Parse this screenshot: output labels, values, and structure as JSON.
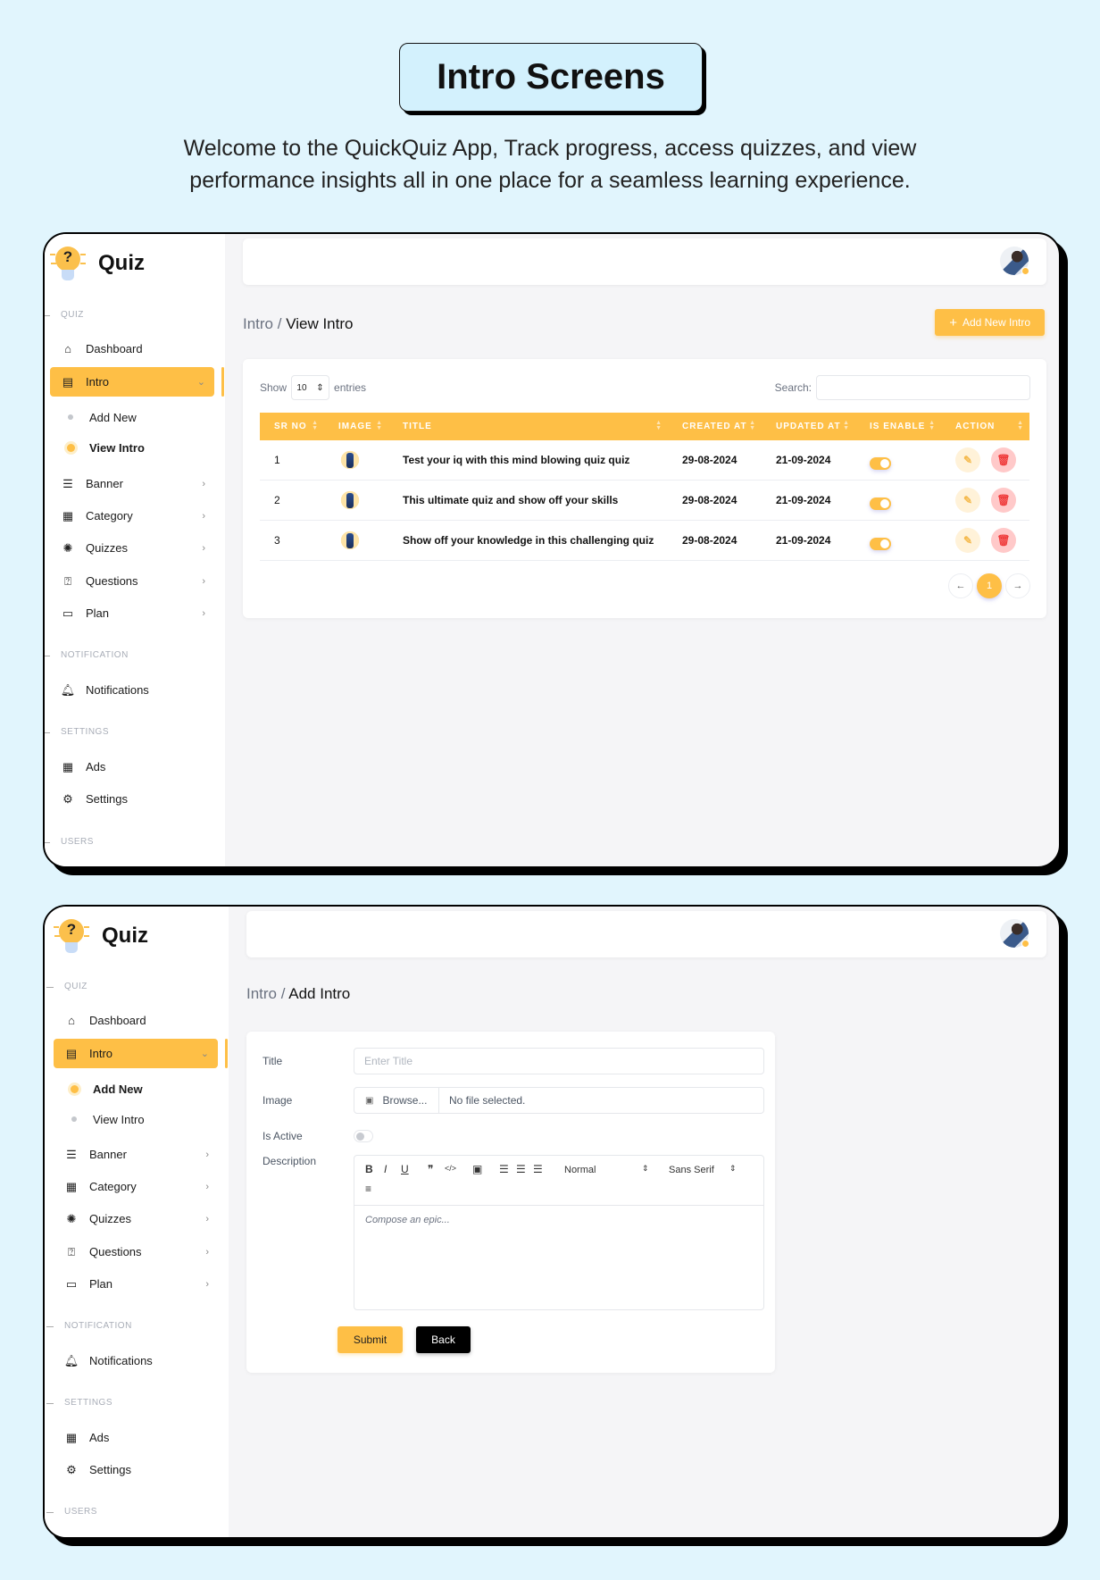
{
  "hero": {
    "title": "Intro Screens",
    "subtitle": "Welcome to the QuickQuiz App, Track progress, access quizzes, and view performance insights all in one place for a seamless learning experience."
  },
  "brand": {
    "name": "Quiz",
    "accent_color": "#febf46"
  },
  "sidebar": {
    "sections": {
      "quiz": "QUIZ",
      "notification": "NOTIFICATION",
      "settings": "SETTINGS",
      "users": "USERS"
    },
    "items": {
      "dashboard": "Dashboard",
      "intro": "Intro",
      "add_new": "Add New",
      "view_intro": "View Intro",
      "banner": "Banner",
      "category": "Category",
      "quizzes": "Quizzes",
      "questions": "Questions",
      "plan": "Plan",
      "notifications": "Notifications",
      "ads": "Ads",
      "settings": "Settings"
    }
  },
  "view_intro": {
    "breadcrumb_parent": "Intro / ",
    "breadcrumb_current": "View Intro",
    "add_button": "Add New Intro",
    "show_label": "Show",
    "entries_value": "10",
    "entries_label": "entries",
    "search_label": "Search:",
    "search_value": "",
    "columns": [
      "SR NO",
      "IMAGE",
      "TITLE",
      "CREATED AT",
      "UPDATED AT",
      "IS ENABLE",
      "ACTION"
    ],
    "rows": [
      {
        "sr": "1",
        "title": "Test your iq with this mind blowing quiz quiz",
        "created": "29-08-2024",
        "updated": "21-09-2024",
        "enabled": true
      },
      {
        "sr": "2",
        "title": "This ultimate quiz and show off your skills",
        "created": "29-08-2024",
        "updated": "21-09-2024",
        "enabled": true
      },
      {
        "sr": "3",
        "title": "Show off your knowledge in this challenging quiz",
        "created": "29-08-2024",
        "updated": "21-09-2024",
        "enabled": true
      }
    ],
    "pagination": {
      "prev": "←",
      "current": "1",
      "next": "→"
    }
  },
  "add_intro": {
    "breadcrumb_parent": "Intro / ",
    "breadcrumb_current": "Add Intro",
    "title_label": "Title",
    "title_placeholder": "Enter Title",
    "image_label": "Image",
    "browse_label": "Browse...",
    "file_status": "No file selected.",
    "active_label": "Is Active",
    "active_value": false,
    "description_label": "Description",
    "toolbar": {
      "bold": "B",
      "italic": "I",
      "underline": "U",
      "quote": "❞",
      "code": "</>",
      "image": "▣",
      "ordered_list": "☰",
      "bullet_list": "☰",
      "check_list": "☰",
      "heading_select": "Normal",
      "font_select": "Sans Serif",
      "align": "≡"
    },
    "editor_placeholder": "Compose an epic...",
    "submit_label": "Submit",
    "back_label": "Back"
  }
}
